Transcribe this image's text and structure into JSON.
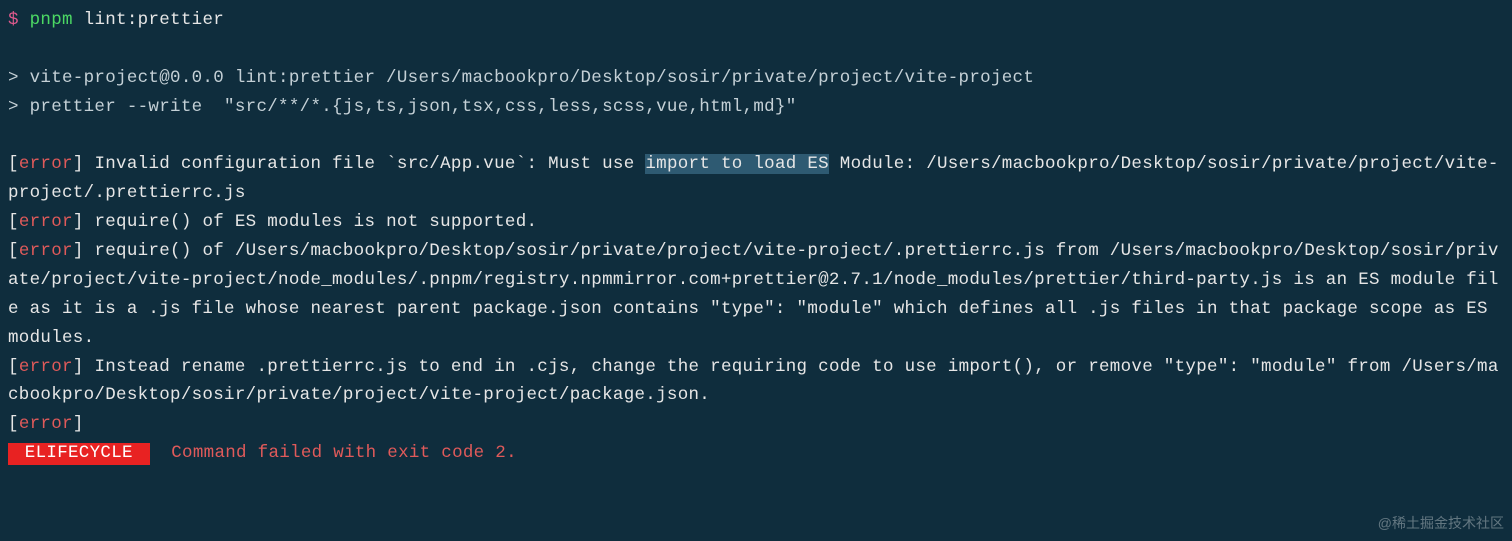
{
  "prompt": {
    "dollar": "$",
    "cmd_first": "pnpm",
    "cmd_rest": " lint:prettier"
  },
  "echo": {
    "line1": "> vite-project@0.0.0 lint:prettier /Users/macbookpro/Desktop/sosir/private/project/vite-project",
    "line2": "> prettier --write  \"src/**/*.{js,ts,json,tsx,css,less,scss,vue,html,md}\""
  },
  "errtag": {
    "open": "[",
    "word": "error",
    "close": "]"
  },
  "err1": {
    "pre": " Invalid configuration file `src/App.vue`: Must use ",
    "highlighted": "import to load ES",
    "post": " Module: /Users/macbookpro/Desktop/sosir/private/project/vite-project/.prettierrc.js"
  },
  "err2": " require() of ES modules is not supported.",
  "err3": " require() of /Users/macbookpro/Desktop/sosir/private/project/vite-project/.prettierrc.js from /Users/macbookpro/Desktop/sosir/private/project/vite-project/node_modules/.pnpm/registry.npmmirror.com+prettier@2.7.1/node_modules/prettier/third-party.js is an ES module file as it is a .js file whose nearest parent package.json contains \"type\": \"module\" which defines all .js files in that package scope as ES modules.",
  "err4": " Instead rename .prettierrc.js to end in .cjs, change the requiring code to use import(), or remove \"type\": \"module\" from /Users/macbookpro/Desktop/sosir/private/project/vite-project/package.json.",
  "lifecycle": {
    "badge": " ELIFECYCLE ",
    "msg": " Command failed with exit code 2."
  },
  "watermark": "@稀土掘金技术社区"
}
